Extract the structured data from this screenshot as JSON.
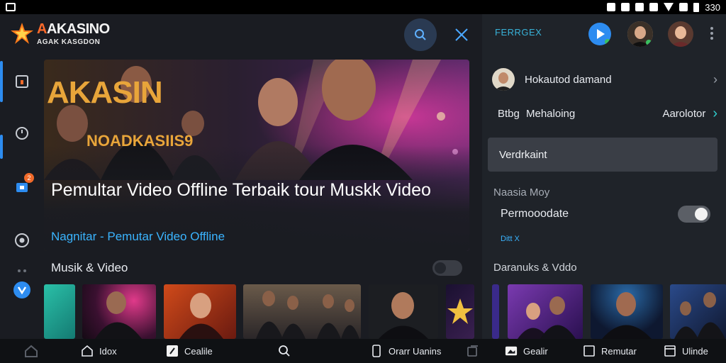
{
  "statusbar": {
    "time": "330"
  },
  "app": {
    "logo_title_accent": "A",
    "logo_title_rest": "AKASINO",
    "logo_subtitle": "AGAK KASGDON",
    "rail": {
      "badge_count": "2"
    }
  },
  "hero": {
    "stamp_big": "AKASIN",
    "stamp_small": "NOADKASIIS9",
    "title": "Pemultar Video Offline Terbaik tour Muskk Video",
    "subtitle": "Nagnitar - Pemutar Video Offline"
  },
  "section": {
    "title": "Musik & Video"
  },
  "panel": {
    "label": "FERRGEX",
    "account_name": "Hokautod damand",
    "row2_col1": "Btbg",
    "row2_col2": "Mehaloing",
    "row2_col3": "Aarolotor",
    "field_value": "Verdrkaint",
    "section_label": "Naasia Moy",
    "toggle_label": "Permooodate",
    "small_link": "Ditt X",
    "section_label2": "Daranuks & Vddo"
  },
  "bottomnav": {
    "item1": "Idox",
    "item2": "Cealile",
    "item3": "Orarr Uanins",
    "item4": "Gealir",
    "item5": "Remutar",
    "item6": "Ulinde"
  },
  "colors": {
    "accent_blue": "#2d8cf0",
    "accent_orange": "#ff6a2b",
    "link_blue": "#3ab4ff",
    "panel_bg": "#1f2329",
    "app_bg": "#1a1c22"
  }
}
